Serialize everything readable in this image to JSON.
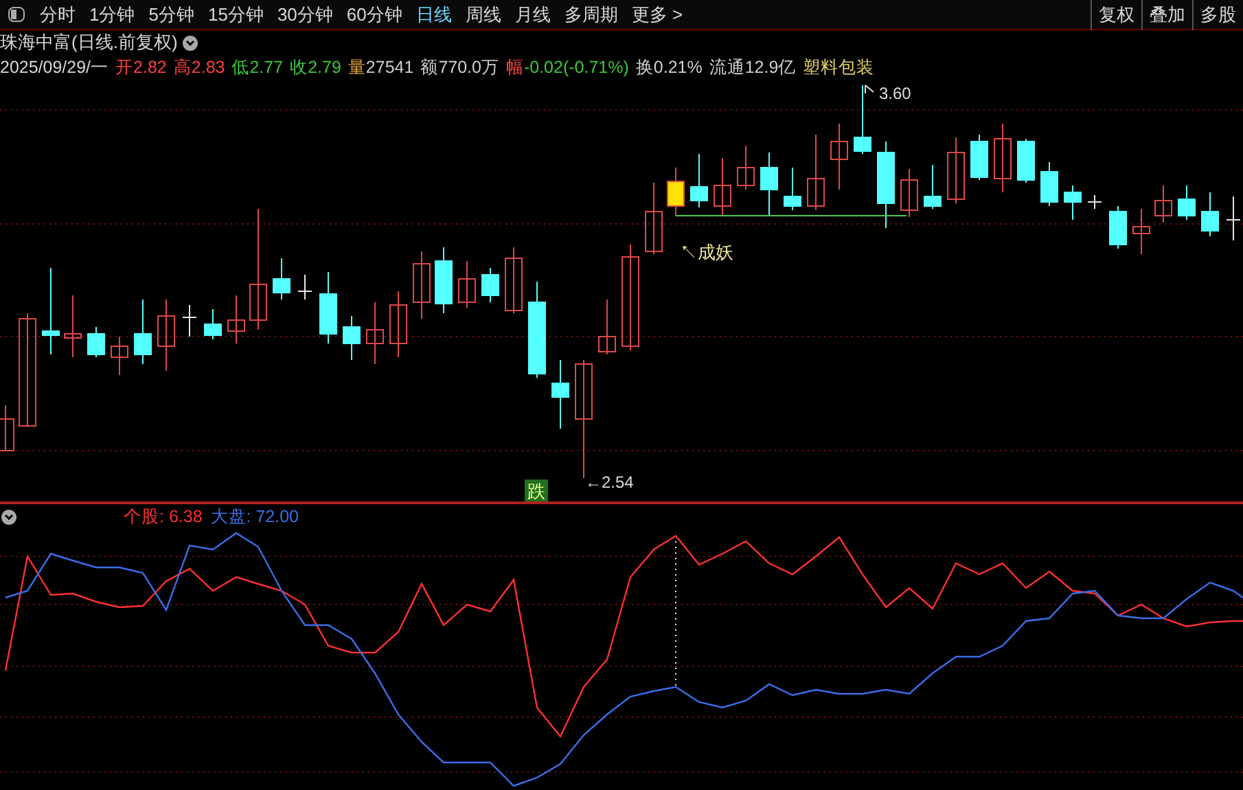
{
  "toolbar": {
    "periods": [
      {
        "label": "分时",
        "selected": false
      },
      {
        "label": "1分钟",
        "selected": false
      },
      {
        "label": "5分钟",
        "selected": false
      },
      {
        "label": "15分钟",
        "selected": false
      },
      {
        "label": "30分钟",
        "selected": false
      },
      {
        "label": "60分钟",
        "selected": false
      },
      {
        "label": "日线",
        "selected": true
      },
      {
        "label": "周线",
        "selected": false
      },
      {
        "label": "月线",
        "selected": false
      },
      {
        "label": "多周期",
        "selected": false
      },
      {
        "label": "更多 >",
        "selected": false
      }
    ],
    "buttons": [
      "复权",
      "叠加",
      "多股"
    ]
  },
  "stock": {
    "title": "珠海中富(日线.前复权)",
    "date": "2025/09/29/一",
    "stats": [
      {
        "parts": [
          {
            "text": "开2.82",
            "color": "#ff4040"
          }
        ]
      },
      {
        "parts": [
          {
            "text": "高2.83",
            "color": "#ff4040"
          }
        ]
      },
      {
        "parts": [
          {
            "text": "低2.77",
            "color": "#3cc83c"
          }
        ]
      },
      {
        "parts": [
          {
            "text": "收2.79",
            "color": "#3cc83c"
          }
        ]
      },
      {
        "parts": [
          {
            "text": "量",
            "color": "#e0a040"
          },
          {
            "text": "27541",
            "color": "#d0d0d0"
          }
        ]
      },
      {
        "parts": [
          {
            "text": "额770.0万",
            "color": "#d0d0d0"
          }
        ]
      },
      {
        "parts": [
          {
            "text": "幅",
            "color": "#ff4040"
          },
          {
            "text": "-0.02(-0.71%)",
            "color": "#3cc83c"
          }
        ]
      },
      {
        "parts": [
          {
            "text": "换0.21%",
            "color": "#d0d0d0"
          }
        ]
      },
      {
        "parts": [
          {
            "text": "流通12.9亿",
            "color": "#d0d0d0"
          }
        ]
      }
    ],
    "industry": "塑料包装"
  },
  "main_chart": {
    "high_label": "3.60",
    "low_label": "←2.54",
    "signal_label": "↖成妖",
    "fall_badge": "跌"
  },
  "indicator": {
    "legend": [
      {
        "label": "个股: 6.38",
        "color": "#ff3030"
      },
      {
        "label": "大盘: 72.00",
        "color": "#3a6ee8"
      }
    ]
  }
}
